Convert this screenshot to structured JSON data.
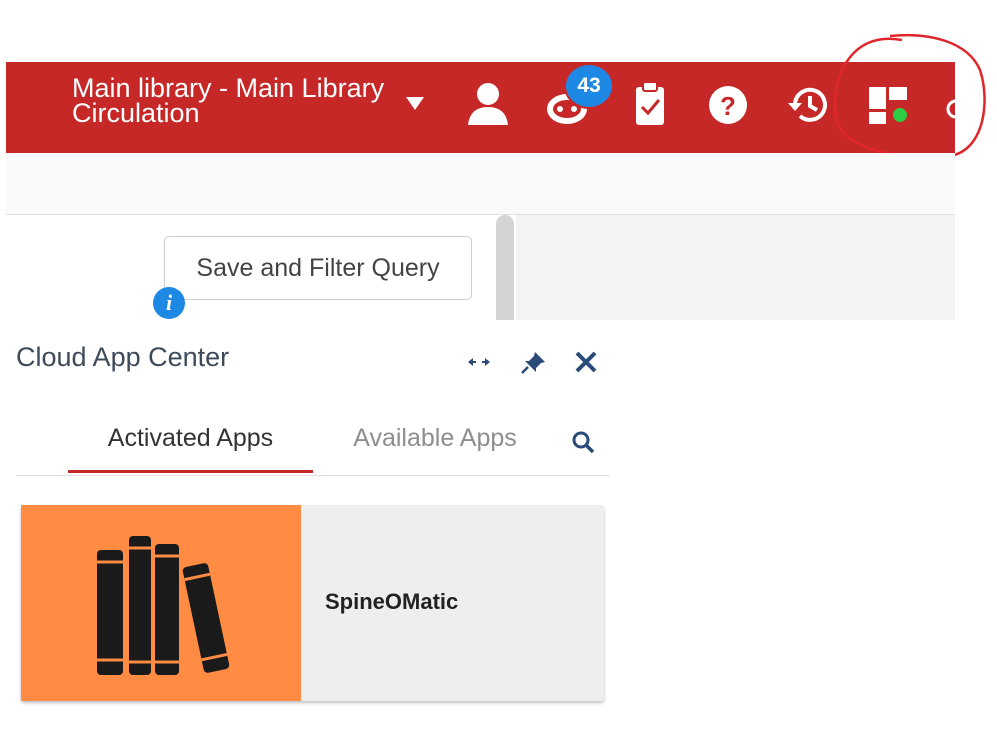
{
  "topbar": {
    "library_line1": "Main library - Main Library",
    "library_line2": "Circulation",
    "notification_count": "43",
    "status_dot_color": "#2ecc40",
    "accent": "#c62828",
    "icons": [
      "user-icon",
      "chat-bot-icon",
      "clipboard-check-icon",
      "help-icon",
      "history-icon",
      "cloud-apps-icon"
    ]
  },
  "toolbar": {
    "save_filter_label": "Save and Filter Query"
  },
  "cloud_app_center": {
    "title": "Cloud App Center",
    "tabs": [
      {
        "label": "Activated Apps",
        "active": true
      },
      {
        "label": "Available Apps",
        "active": false
      }
    ],
    "apps": [
      {
        "name": "SpineOMatic",
        "thumb_color": "#ff8c42",
        "icon": "books-icon"
      }
    ]
  }
}
